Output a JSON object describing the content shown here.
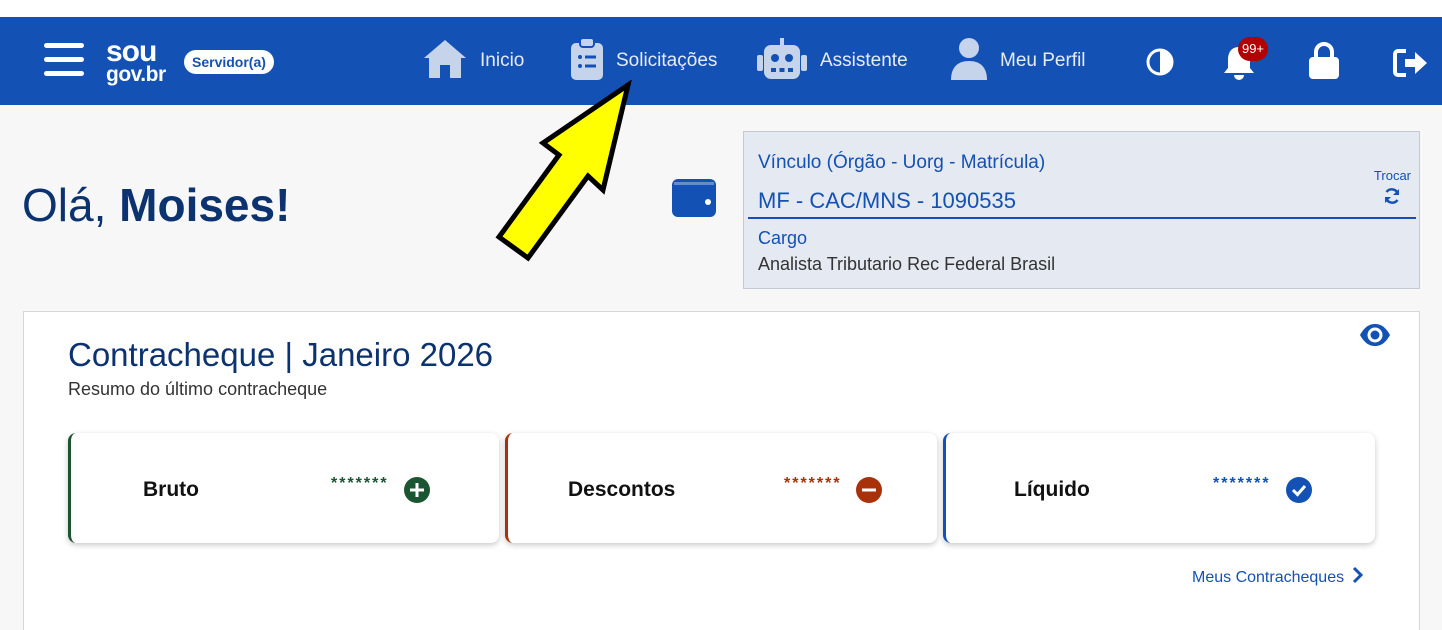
{
  "header": {
    "logo_line1": "sou",
    "logo_line2": "gov.br",
    "role_badge": "Servidor(a)",
    "nav": [
      {
        "label": "Inicio",
        "icon": "home-icon"
      },
      {
        "label": "Solicitações",
        "icon": "clipboard-list-icon"
      },
      {
        "label": "Assistente",
        "icon": "robot-icon"
      },
      {
        "label": "Meu Perfil",
        "icon": "user-icon"
      }
    ],
    "actions": [
      "contrast-icon",
      "bell-icon",
      "lock-icon",
      "logout-icon"
    ],
    "notification_count": "99+"
  },
  "greeting": {
    "prefix": "Olá,",
    "name": "Moises!"
  },
  "vinculo": {
    "label": "Vínculo (Órgão - Uorg - Matrícula)",
    "value": "MF - CAC/MNS - 1090535",
    "switch_label": "Trocar",
    "cargo_label": "Cargo",
    "cargo_value": "Analista Tributario Rec Federal Brasil"
  },
  "payslip": {
    "title": "Contracheque | Janeiro 2026",
    "subtitle": "Resumo do último contracheque",
    "items": [
      {
        "label": "Bruto",
        "masked_value": "*******",
        "icon": "plus-circle-icon",
        "color": "#1c5532"
      },
      {
        "label": "Descontos",
        "masked_value": "*******",
        "icon": "minus-circle-icon",
        "color": "#a8310a"
      },
      {
        "label": "Líquido",
        "masked_value": "*******",
        "icon": "check-circle-icon",
        "color": "#1351b4"
      }
    ],
    "link_label": "Meus Contracheques"
  },
  "colors": {
    "header_bg": "#1351b4",
    "primary_text": "#0c326f",
    "accent": "#1351b4",
    "annotation_arrow": "#ffff00"
  }
}
